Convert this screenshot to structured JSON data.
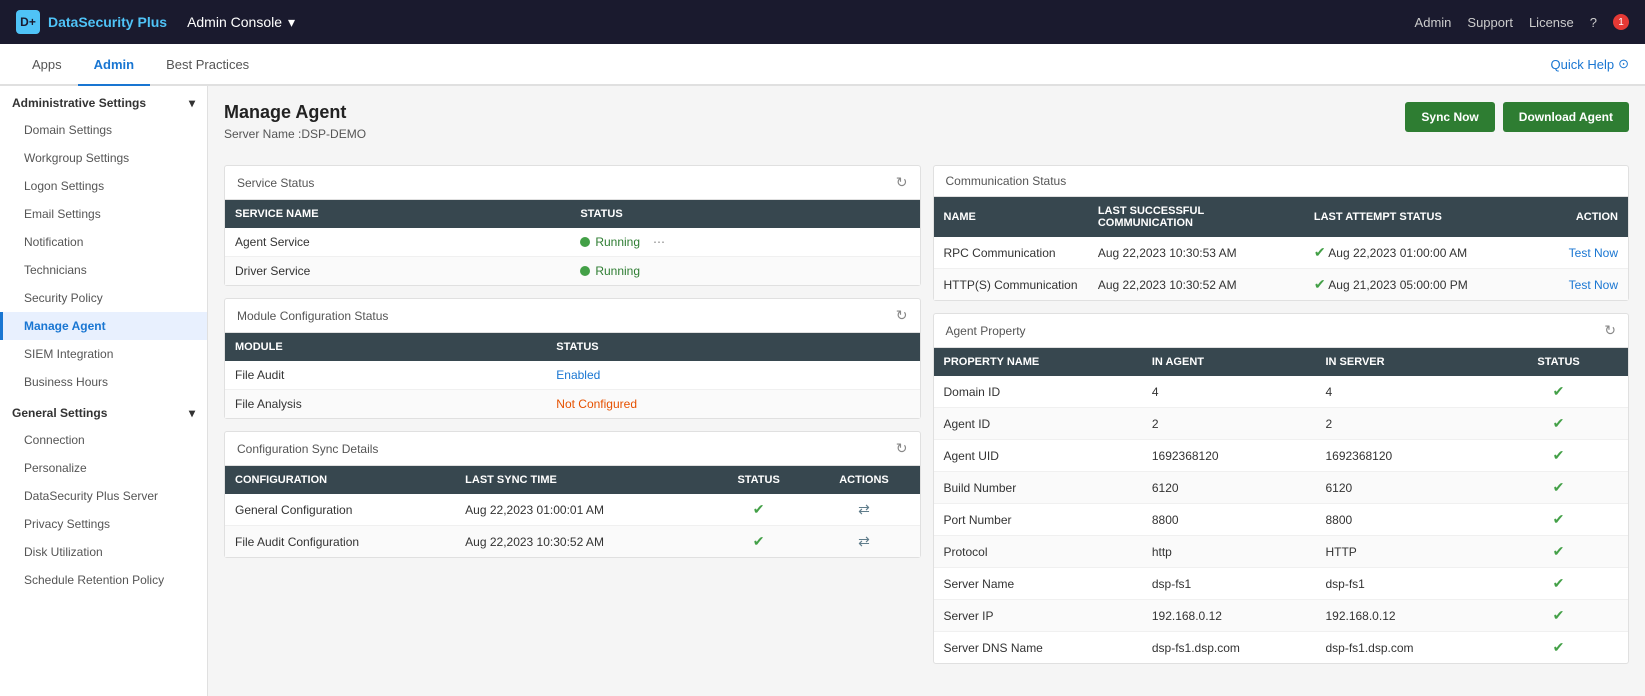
{
  "topBar": {
    "logo": "DataSecurity Plus",
    "logoInitial": "D+",
    "appSelector": "Admin Console",
    "dropdownIcon": "▾",
    "topRight": {
      "admin": "Admin",
      "support": "Support",
      "license": "License",
      "help": "?",
      "notifCount": "1"
    }
  },
  "secNav": {
    "tabs": [
      "Apps",
      "Admin",
      "Best Practices"
    ],
    "activeTab": "Admin",
    "quickHelp": "Quick Help"
  },
  "sidebar": {
    "adminSection": "Administrative Settings",
    "adminItems": [
      {
        "label": "Domain Settings",
        "active": false
      },
      {
        "label": "Workgroup Settings",
        "active": false
      },
      {
        "label": "Logon Settings",
        "active": false
      },
      {
        "label": "Email Settings",
        "active": false
      },
      {
        "label": "Notification",
        "active": false
      },
      {
        "label": "Technicians",
        "active": false
      },
      {
        "label": "Security Policy",
        "active": false
      },
      {
        "label": "Manage Agent",
        "active": true
      },
      {
        "label": "SIEM Integration",
        "active": false
      },
      {
        "label": "Business Hours",
        "active": false
      }
    ],
    "generalSection": "General Settings",
    "generalItems": [
      {
        "label": "Connection",
        "active": false
      },
      {
        "label": "Personalize",
        "active": false
      },
      {
        "label": "DataSecurity Plus Server",
        "active": false
      },
      {
        "label": "Privacy Settings",
        "active": false
      },
      {
        "label": "Disk Utilization",
        "active": false
      },
      {
        "label": "Schedule Retention Policy",
        "active": false
      }
    ]
  },
  "main": {
    "pageTitle": "Manage Agent",
    "serverName": "Server Name :DSP-DEMO",
    "syncNow": "Sync Now",
    "downloadAgent": "Download Agent",
    "serviceStatus": {
      "title": "Service Status",
      "columns": [
        "Service Name",
        "Status"
      ],
      "rows": [
        {
          "name": "Agent Service",
          "status": "Running",
          "hasMenu": true
        },
        {
          "name": "Driver Service",
          "status": "Running",
          "hasMenu": false
        }
      ]
    },
    "moduleConfig": {
      "title": "Module Configuration Status",
      "columns": [
        "Module",
        "Status"
      ],
      "rows": [
        {
          "name": "File Audit",
          "status": "Enabled",
          "statusClass": "enabled"
        },
        {
          "name": "File Analysis",
          "status": "Not Configured",
          "statusClass": "not-configured"
        }
      ]
    },
    "configSync": {
      "title": "Configuration Sync Details",
      "columns": [
        "Configuration",
        "Last Sync Time",
        "Status",
        "Actions"
      ],
      "rows": [
        {
          "name": "General Configuration",
          "lastSync": "Aug 22,2023 01:00:01 AM",
          "status": "ok"
        },
        {
          "name": "File Audit Configuration",
          "lastSync": "Aug 22,2023 10:30:52 AM",
          "status": "ok"
        }
      ]
    },
    "commStatus": {
      "title": "Communication Status",
      "columns": [
        "Name",
        "Last Successful Communication",
        "Last Attempt Status",
        "Action"
      ],
      "rows": [
        {
          "name": "RPC Communication",
          "lastSuccess": "Aug 22,2023 10:30:53 AM",
          "lastAttempt": "Aug 22,2023 01:00:00 AM",
          "action": "Test Now"
        },
        {
          "name": "HTTP(S) Communication",
          "lastSuccess": "Aug 22,2023 10:30:52 AM",
          "lastAttempt": "Aug 21,2023 05:00:00 PM",
          "action": "Test Now"
        }
      ]
    },
    "agentProperty": {
      "title": "Agent Property",
      "columns": [
        "Property Name",
        "In Agent",
        "In Server",
        "Status"
      ],
      "rows": [
        {
          "property": "Domain ID",
          "inAgent": "4",
          "inServer": "4",
          "match": true
        },
        {
          "property": "Agent ID",
          "inAgent": "2",
          "inServer": "2",
          "match": true
        },
        {
          "property": "Agent UID",
          "inAgent": "1692368120",
          "inServer": "1692368120",
          "match": true
        },
        {
          "property": "Build Number",
          "inAgent": "6120",
          "inServer": "6120",
          "match": true
        },
        {
          "property": "Port Number",
          "inAgent": "8800",
          "inServer": "8800",
          "match": true
        },
        {
          "property": "Protocol",
          "inAgent": "http",
          "inServer": "HTTP",
          "match": true
        },
        {
          "property": "Server Name",
          "inAgent": "dsp-fs1",
          "inServer": "dsp-fs1",
          "match": true
        },
        {
          "property": "Server IP",
          "inAgent": "192.168.0.12",
          "inServer": "192.168.0.12",
          "match": true
        },
        {
          "property": "Server DNS Name",
          "inAgent": "dsp-fs1.dsp.com",
          "inServer": "dsp-fs1.dsp.com",
          "match": true
        }
      ]
    }
  }
}
